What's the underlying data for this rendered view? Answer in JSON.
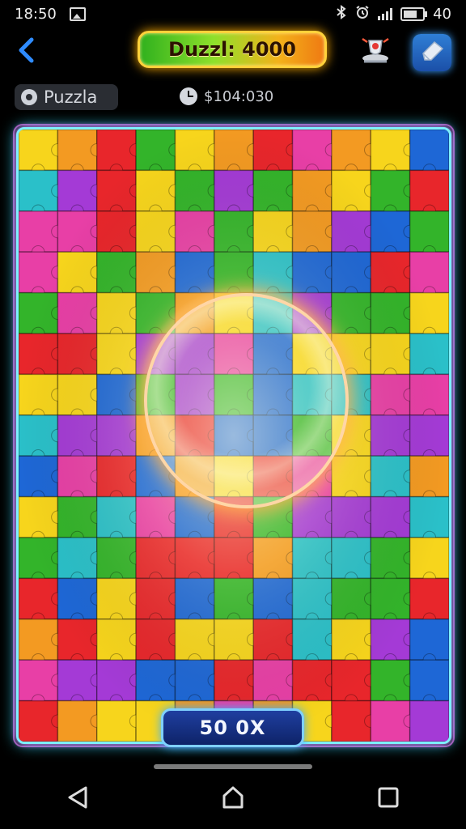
{
  "status_bar": {
    "time": "18:50",
    "battery": "40",
    "icons": [
      "gallery-icon",
      "bluetooth-icon",
      "alarm-icon",
      "signal-icon",
      "battery-icon"
    ]
  },
  "header": {
    "back_icon": "chevron-left-icon",
    "title": "Duzzl: 4000",
    "trophy_icon": "trophy-icon",
    "settings_icon": "eraser-icon"
  },
  "subheader": {
    "mode_label": "Puzzla",
    "timer_text": "$104:030"
  },
  "board": {
    "rows": 15,
    "cols": 11,
    "palette": [
      "#e8262b",
      "#33b42a",
      "#1e67d6",
      "#f7d51c",
      "#f39a22",
      "#a43ad6",
      "#2ac0c9",
      "#e83fa6"
    ],
    "highlight_color": "#ffd6a6",
    "frame_colors": [
      "#7df0ff",
      "#ff4ee6",
      "#ffff66"
    ]
  },
  "score_button": {
    "label": "50 0X"
  },
  "nav": {
    "back": "triangle-back-icon",
    "home": "home-icon",
    "recents": "square-recents-icon"
  }
}
